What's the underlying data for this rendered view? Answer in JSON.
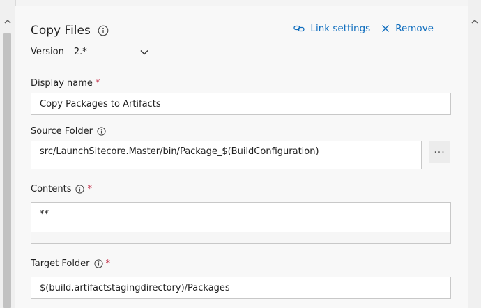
{
  "task": {
    "title": "Copy Files",
    "version_label": "Version",
    "version_value": "2.*"
  },
  "actions": {
    "link_settings": "Link settings",
    "remove": "Remove"
  },
  "fields": {
    "display_name": {
      "label": "Display name",
      "required": "*",
      "value": "Copy Packages to Artifacts"
    },
    "source_folder": {
      "label": "Source Folder",
      "value": "src/LaunchSitecore.Master/bin/Package_$(BuildConfiguration)",
      "browse_label": "···"
    },
    "contents": {
      "label": "Contents",
      "required": "*",
      "value": "**"
    },
    "target_folder": {
      "label": "Target Folder",
      "required": "*",
      "value": "$(build.artifactstagingdirectory)/Packages"
    }
  },
  "colors": {
    "accent": "#106ebe",
    "required": "#c4314b",
    "border": "#c8c8c8",
    "panel_bg": "#f8f8f8"
  },
  "icons": [
    "info-icon",
    "link-icon",
    "close-icon",
    "chevron-down-icon",
    "scroll-up-icon"
  ]
}
